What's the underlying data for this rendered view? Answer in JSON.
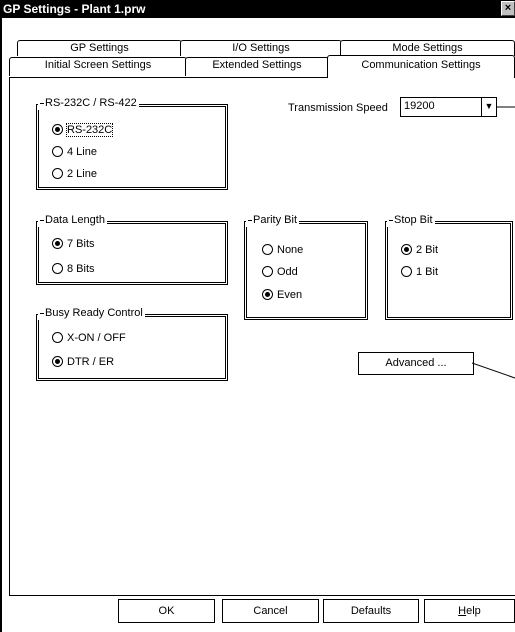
{
  "window": {
    "title": "GP Settings - Plant 1.prw",
    "close_glyph": "×"
  },
  "tabs": {
    "row1": [
      "GP Settings",
      "I/O Settings",
      "Mode Settings"
    ],
    "row2": [
      "Initial Screen Settings",
      "Extended Settings",
      "Communication Settings"
    ],
    "active": "Communication Settings"
  },
  "rs232": {
    "title": "RS-232C / RS-422",
    "options": [
      "RS-232C",
      "4 Line",
      "2 Line"
    ],
    "selected": "RS-232C"
  },
  "transmission": {
    "label": "Transmission Speed",
    "value": "19200",
    "arrow": "▼"
  },
  "data_length": {
    "title": "Data Length",
    "options": [
      "7 Bits",
      "8 Bits"
    ],
    "selected": "7 Bits"
  },
  "parity": {
    "title": "Parity Bit",
    "options": [
      "None",
      "Odd",
      "Even"
    ],
    "selected": "Even"
  },
  "stop_bit": {
    "title": "Stop Bit",
    "options": [
      "2 Bit",
      "1 Bit"
    ],
    "selected": "2 Bit"
  },
  "busy": {
    "title": "Busy Ready Control",
    "options": [
      "X-ON / OFF",
      "DTR / ER"
    ],
    "selected": "DTR / ER"
  },
  "advanced_button": "Advanced ...",
  "footer": {
    "ok": "OK",
    "cancel": "Cancel",
    "defaults": "Defaults",
    "help_h": "H",
    "help_rest": "elp"
  }
}
